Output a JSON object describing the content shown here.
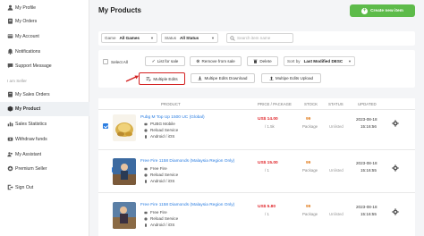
{
  "sidebar": {
    "items": [
      {
        "label": "My Profile",
        "icon": "user-icon"
      },
      {
        "label": "My Orders",
        "icon": "orders-icon"
      },
      {
        "label": "My Account",
        "icon": "account-icon"
      },
      {
        "label": "Notifications",
        "icon": "bell-icon"
      },
      {
        "label": "Support Message",
        "icon": "message-icon"
      }
    ],
    "section_label": "I am Seller",
    "seller_items": [
      {
        "label": "My Sales Orders",
        "icon": "sales-orders-icon"
      },
      {
        "label": "My Product",
        "icon": "product-icon",
        "active": true
      },
      {
        "label": "Sales Statistics",
        "icon": "statistics-icon"
      },
      {
        "label": "Withdraw funds",
        "icon": "withdraw-icon"
      },
      {
        "label": "My Assistant",
        "icon": "assistant-icon"
      },
      {
        "label": "Premium Seller",
        "icon": "premium-icon"
      }
    ],
    "signout": {
      "label": "Sign Out",
      "icon": "signout-icon"
    }
  },
  "main": {
    "title": "My Products",
    "create_button": "Create new item"
  },
  "filters": {
    "game_label": "Game",
    "game_value": "All Games",
    "status_label": "Status",
    "status_value": "All Status",
    "search_placeholder": "Search item name"
  },
  "actions": {
    "select_all": "Select All",
    "list_for_sale": "List for sale",
    "remove_from_sale": "Remove from sale",
    "delete": "Delete",
    "sort_label": "Sort by",
    "sort_value": "Last Modified DESC",
    "multiple_edits": "Multiple Edits",
    "multiple_edits_download": "Multipe Edits Download",
    "multiple_edits_upload": "Multipe Edits Upload"
  },
  "table": {
    "headers": {
      "product": "PRODUCT",
      "price": "PRICE / PACKAGE",
      "stock": "STOCK",
      "status": "STATUS",
      "updated": "UPDATED"
    },
    "rows": [
      {
        "name": "Pubg M Top Up 1500 UC (Global)",
        "game": "PUBG Mobile",
        "service": "Reload Service",
        "platform": "Android / iOS",
        "price": "US$ 14.00",
        "per": "/ 1.5k",
        "stock": "99",
        "stock_unit": "Package",
        "status": "Unlisted",
        "date": "2023-08-18",
        "time": "15:16:56",
        "checked": true
      },
      {
        "name": "Free Fire 1158 Diamonds (Malaysia Region Only)",
        "game": "Free Fire",
        "service": "Reload Service",
        "platform": "Android / iOS",
        "price": "US$ 15.00",
        "per": "/ 1",
        "stock": "99",
        "stock_unit": "Package",
        "status": "Unlisted",
        "date": "2023-08-18",
        "time": "15:16:55",
        "checked": true
      },
      {
        "name": "Free Fire 1158 Diamonds (Malaysia Region Only)",
        "game": "Free Fire",
        "service": "Reload Service",
        "platform": "Android / iOS",
        "price": "US$ 5.80",
        "per": "/ 1",
        "stock": "99",
        "stock_unit": "Package",
        "status": "Unlisted",
        "date": "2023-08-18",
        "time": "15:16:55",
        "checked": true
      }
    ]
  },
  "colors": {
    "accent_blue": "#2a7de1",
    "create_green": "#5dbb4a",
    "price_red": "#e0252a",
    "stock_orange": "#e07a1a",
    "highlight_red": "#d32020"
  }
}
